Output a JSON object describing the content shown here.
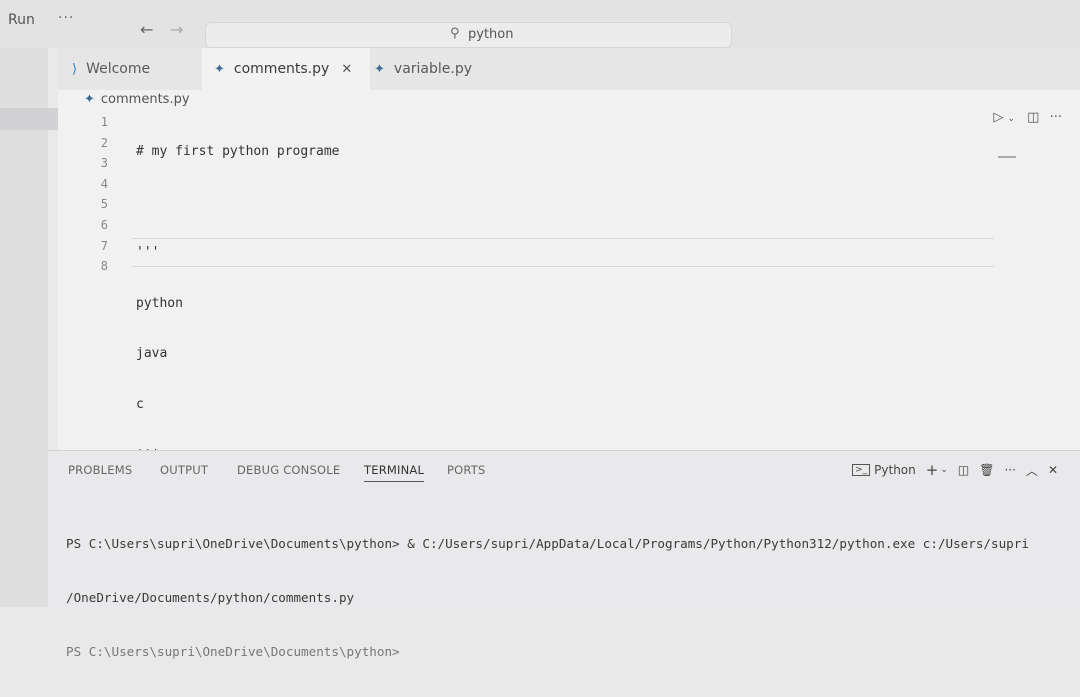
{
  "titlebar": {
    "menu_run": "Run",
    "menu_more": "···",
    "back_icon": "←",
    "forward_icon": "→",
    "search_text": "python"
  },
  "activity": {
    "more": "···"
  },
  "tabs": [
    {
      "label": "Welcome",
      "icon": "vscode-logo"
    },
    {
      "label": "comments.py",
      "icon": "python-icon",
      "close": "✕"
    },
    {
      "label": "variable.py",
      "icon": "python-icon"
    }
  ],
  "breadcrumb": {
    "file": "comments.py"
  },
  "editor": {
    "line_numbers": [
      "1",
      "2",
      "3",
      "4",
      "5",
      "6",
      "7",
      "8"
    ],
    "lines": [
      "# my first python programe",
      "",
      "'''",
      "python",
      "java",
      "c",
      "'''",
      ""
    ]
  },
  "panel": {
    "tabs": [
      "PROBLEMS",
      "OUTPUT",
      "DEBUG CONSOLE",
      "TERMINAL",
      "PORTS"
    ],
    "active_tab": "TERMINAL",
    "terminal_name": "Python",
    "terminal_lines": [
      "PS C:\\Users\\supri\\OneDrive\\Documents\\python> & C:/Users/supri/AppData/Local/Programs/Python/Python312/python.exe c:/Users/supri",
      "/OneDrive/Documents/python/comments.py",
      "PS C:\\Users\\supri\\OneDrive\\Documents\\python>"
    ]
  },
  "colors": {
    "python_icon": "#3d6b93",
    "vscode_logo": "#2b7bd0",
    "background": "#f1f1f2"
  }
}
